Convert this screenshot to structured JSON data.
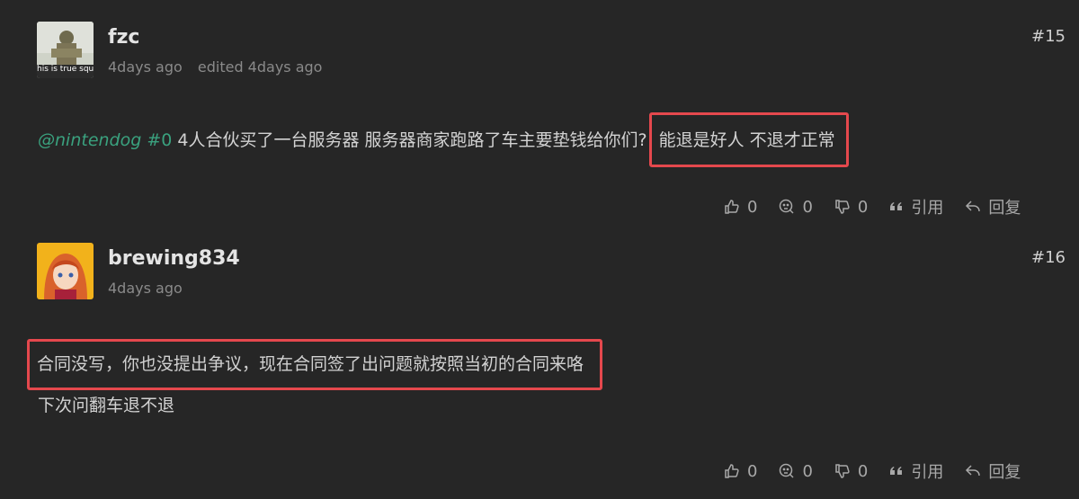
{
  "posts": [
    {
      "username": "fzc",
      "time": "4days ago",
      "edited": "edited 4days ago",
      "floor": "#15",
      "avatar_caption": "his is true squa",
      "mention": "@nintendog",
      "floor_ref": "#0",
      "text": "4人合伙买了一台服务器 服务器商家跑路了车主要垫钱给你们?",
      "highlight": "能退是好人 不退才正常",
      "actions": {
        "like": "0",
        "think": "0",
        "dislike": "0",
        "quote": "引用",
        "reply": "回复"
      }
    },
    {
      "username": "brewing834",
      "time": "4days ago",
      "floor": "#16",
      "highlight": "合同没写，你也没提出争议，现在合同签了出问题就按照当初的合同来咯",
      "line2": "下次问翻车退不退",
      "actions": {
        "like": "0",
        "think": "0",
        "dislike": "0",
        "quote": "引用",
        "reply": "回复"
      }
    }
  ],
  "colors": {
    "background": "#262626",
    "mention": "#3aa17e",
    "highlight_box": "#e5484d"
  }
}
